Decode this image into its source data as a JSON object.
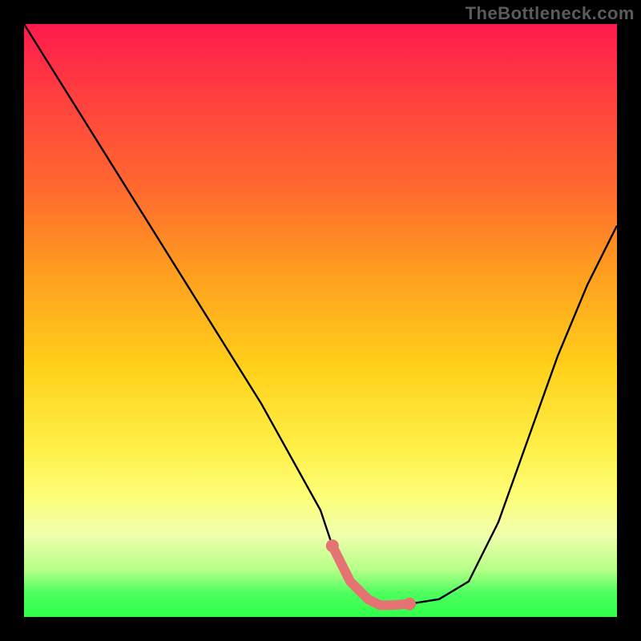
{
  "watermark": "TheBottleneck.com",
  "colors": {
    "curve": "#000000",
    "highlight": "#e57373",
    "gradient_top": "#ff1a4d",
    "gradient_bottom": "#2fff4a",
    "frame": "#000000"
  },
  "chart_data": {
    "type": "line",
    "title": "",
    "xlabel": "",
    "ylabel": "",
    "xlim": [
      0,
      100
    ],
    "ylim": [
      0,
      100
    ],
    "grid": false,
    "legend": false,
    "series": [
      {
        "name": "bottleneck-curve",
        "x": [
          0,
          5,
          10,
          15,
          20,
          25,
          30,
          35,
          40,
          45,
          50,
          52,
          55,
          58,
          60,
          62,
          65,
          70,
          75,
          80,
          85,
          90,
          95,
          100
        ],
        "y": [
          100,
          92,
          84,
          76,
          68,
          60,
          52,
          44,
          36,
          27,
          18,
          12,
          6,
          3,
          2,
          2,
          2.2,
          3,
          6,
          16,
          30,
          44,
          56,
          66
        ]
      }
    ],
    "highlight_range_x": [
      52,
      66
    ],
    "background": "vertical-gradient red→yellow→green"
  }
}
